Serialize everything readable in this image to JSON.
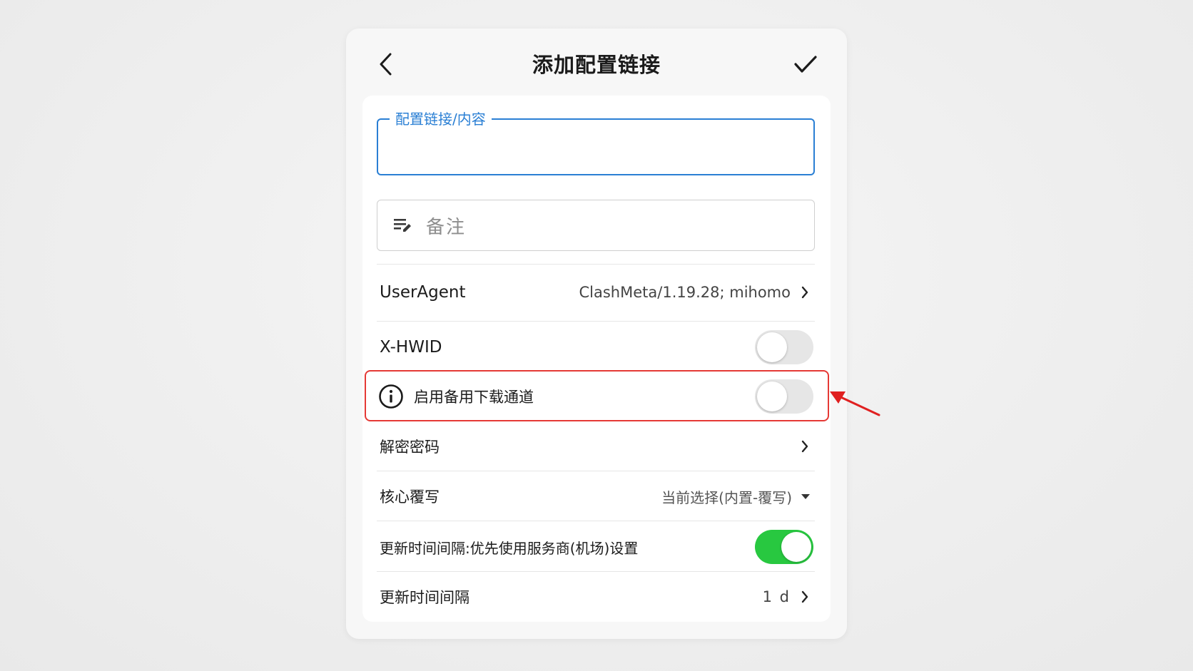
{
  "header": {
    "title": "添加配置链接"
  },
  "form": {
    "url_label": "配置链接/内容",
    "url_value": "",
    "note_placeholder": "备注"
  },
  "rows": {
    "user_agent": {
      "label": "UserAgent",
      "value": "ClashMeta/1.19.28; mihomo"
    },
    "x_hwid": {
      "label": "X-HWID",
      "enabled": false
    },
    "backup_channel": {
      "label": "启用备用下载通道",
      "enabled": false
    },
    "decrypt_password": {
      "label": "解密密码"
    },
    "core_override": {
      "label": "核心覆写",
      "value": "当前选择(内置-覆写)"
    },
    "prefer_provider_interval": {
      "label": "更新时间间隔:优先使用服务商(机场)设置",
      "enabled": true
    },
    "update_interval": {
      "label": "更新时间间隔",
      "value": "1 d"
    }
  },
  "icons": {
    "back": "chevron-left-icon",
    "confirm": "checkmark-icon",
    "note": "notes-edit-icon",
    "info": "info-circle-icon",
    "chevron": "chevron-right-icon",
    "caret": "caret-down-icon",
    "annotation": "red-arrow-icon"
  },
  "colors": {
    "accent": "#2a7fd4",
    "toggle_on": "#28c840",
    "toggle_off": "#e6e6e6",
    "highlight": "#e53935"
  }
}
